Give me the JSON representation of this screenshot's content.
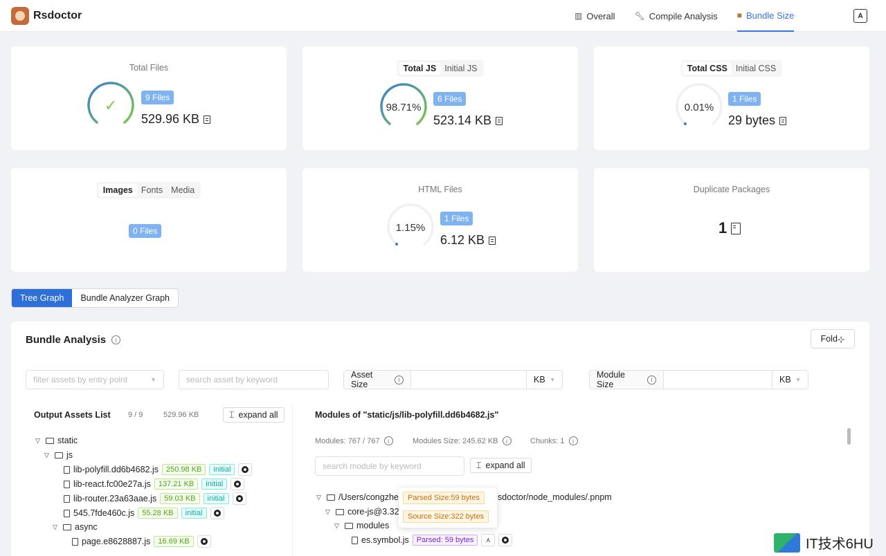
{
  "header": {
    "app_name": "Rsdoctor",
    "nav": [
      {
        "label": "Overall",
        "icon": "bar-chart-icon"
      },
      {
        "label": "Compile Analysis",
        "icon": "wrench-icon"
      },
      {
        "label": "Bundle Size",
        "icon": "package-icon",
        "active": true
      }
    ]
  },
  "cards": {
    "total_files": {
      "title": "Total Files",
      "files": "9 Files",
      "size": "529.96 KB",
      "ring_percent": 100
    },
    "total_js": {
      "tabs": [
        "Total JS",
        "Initial JS"
      ],
      "percent": "98.71%",
      "files": "6 Files",
      "size": "523.14 KB",
      "ring_percent": 98.71
    },
    "total_css": {
      "tabs": [
        "Total CSS",
        "Initial CSS"
      ],
      "percent": "0.01%",
      "files": "1 Files",
      "size": "29 bytes",
      "ring_percent": 0.01
    },
    "media": {
      "tabs": [
        "Images",
        "Fonts",
        "Media"
      ],
      "files": "0 Files"
    },
    "html": {
      "title": "HTML Files",
      "percent": "1.15%",
      "files": "1 Files",
      "size": "6.12 KB",
      "ring_percent": 1.15
    },
    "duplicate": {
      "title": "Duplicate Packages",
      "count": "1"
    }
  },
  "graph_tabs": [
    "Tree Graph",
    "Bundle Analyzer Graph"
  ],
  "analysis": {
    "title": "Bundle Analysis",
    "fold_label": "Fold",
    "filter_placeholder": "filter assets by entry point",
    "search_placeholder": "search asset by keyword",
    "asset_size_label": "Asset Size",
    "module_size_label": "Module Size",
    "unit": "KB",
    "output_title": "Output Assets List",
    "output_count": "9 / 9",
    "output_size": "529.96 KB",
    "expand_all": "expand all",
    "tree": [
      {
        "label": "static",
        "type": "folder"
      },
      {
        "label": "js",
        "type": "folder"
      },
      {
        "label": "lib-polyfill.dd6b4682.js",
        "size": "250.98 KB",
        "tag": "initial"
      },
      {
        "label": "lib-react.fc00e27a.js",
        "size": "137.21 KB",
        "tag": "initial"
      },
      {
        "label": "lib-router.23a63aae.js",
        "size": "59.03 KB",
        "tag": "initial"
      },
      {
        "label": "545.7fde460c.js",
        "size": "55.28 KB",
        "tag": "initial"
      },
      {
        "label": "async",
        "type": "folder"
      },
      {
        "label": "page.e8628887.js",
        "size": "16.69 KB"
      }
    ],
    "modules_title": "Modules of \"static/js/lib-polyfill.dd6b4682.js\"",
    "modules_count": "Modules: 767 / 767",
    "modules_size": "Modules Size: 245.62 KB",
    "chunks": "Chunks: 1",
    "module_search_placeholder": "search module by keyword",
    "module_tree": [
      {
        "label": "/Users/congzhe",
        "suffix": "sdoctor/node_modules/.pnpm"
      },
      {
        "label": "core-js@3.32"
      },
      {
        "label": "modules"
      },
      {
        "label": "es.symbol.js",
        "parsed": "Parsed: 59 bytes"
      }
    ],
    "popover": {
      "parsed": "Parsed Size:59 bytes",
      "source": "Source Size:322 bytes"
    }
  },
  "watermark": "IT技术6HU"
}
